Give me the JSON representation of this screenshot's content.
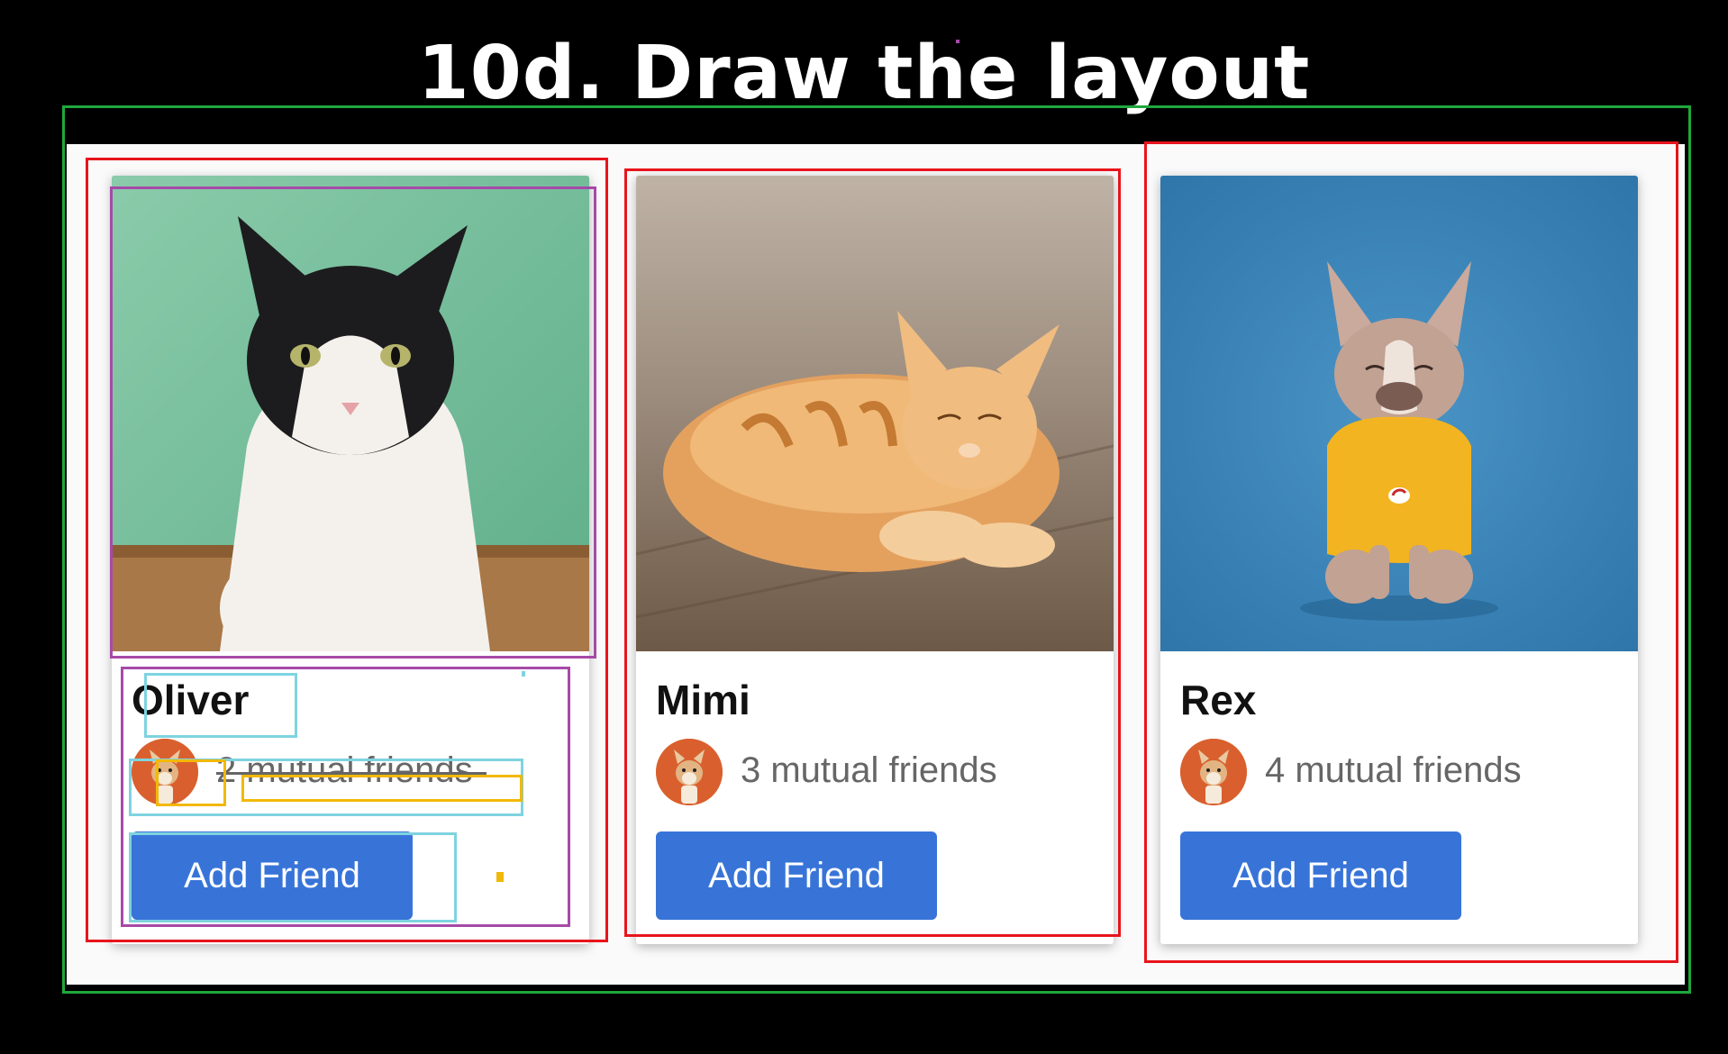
{
  "slide": {
    "title": "10d. Draw the layout"
  },
  "cards": [
    {
      "name": "Oliver",
      "mutual_friends": "2 mutual friends",
      "button_label": "Add Friend",
      "photo": "black-and-white cat leaning on wooden table, mint green background",
      "avatar": "corgi-avatar"
    },
    {
      "name": "Mimi",
      "mutual_friends": "3 mutual friends",
      "button_label": "Add Friend",
      "photo": "orange tabby cat lying on wooden floor",
      "avatar": "corgi-avatar"
    },
    {
      "name": "Rex",
      "mutual_friends": "4 mutual friends",
      "button_label": "Add Friend",
      "photo": "french bulldog in yellow sweater, blue background",
      "avatar": "corgi-avatar"
    }
  ],
  "colors": {
    "button_bg": "#3874d8",
    "annotation_green": "#1fa83c",
    "annotation_red": "#e8141c",
    "annotation_purple": "#a64aa8",
    "annotation_cyan": "#7fd3e0",
    "annotation_yellow": "#f2b807"
  }
}
